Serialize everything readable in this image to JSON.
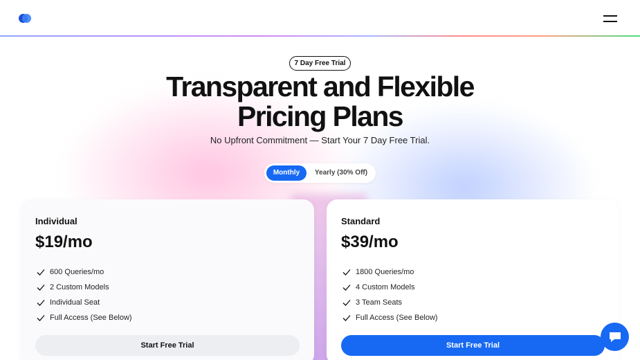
{
  "header": {
    "logo": "logo-mark",
    "menu_icon": "hamburger-icon"
  },
  "hero": {
    "badge": "7 Day Free Trial",
    "title_line1": "Transparent and Flexible",
    "title_line2": "Pricing Plans",
    "subtitle": "No Upfront Commitment — Start Your 7 Day Free Trial."
  },
  "billing_toggle": {
    "monthly": "Monthly",
    "yearly": "Yearly (30% Off)",
    "selected": "Monthly"
  },
  "plans": [
    {
      "name": "Individual",
      "price": "$19/mo",
      "features": [
        "600 Queries/mo",
        "2 Custom Models",
        "Individual Seat",
        "Full Access (See Below)"
      ],
      "cta": "Start Free Trial"
    },
    {
      "name": "Standard",
      "price": "$39/mo",
      "features": [
        "1800 Queries/mo",
        "4 Custom Models",
        "3 Team Seats",
        "Full Access (See Below)"
      ],
      "cta": "Start Free Trial"
    }
  ],
  "chat": {
    "icon": "chat-bubble-icon"
  },
  "colors": {
    "accent": "#1769f4",
    "text": "#111111",
    "secondary_button": "#eceef2"
  }
}
